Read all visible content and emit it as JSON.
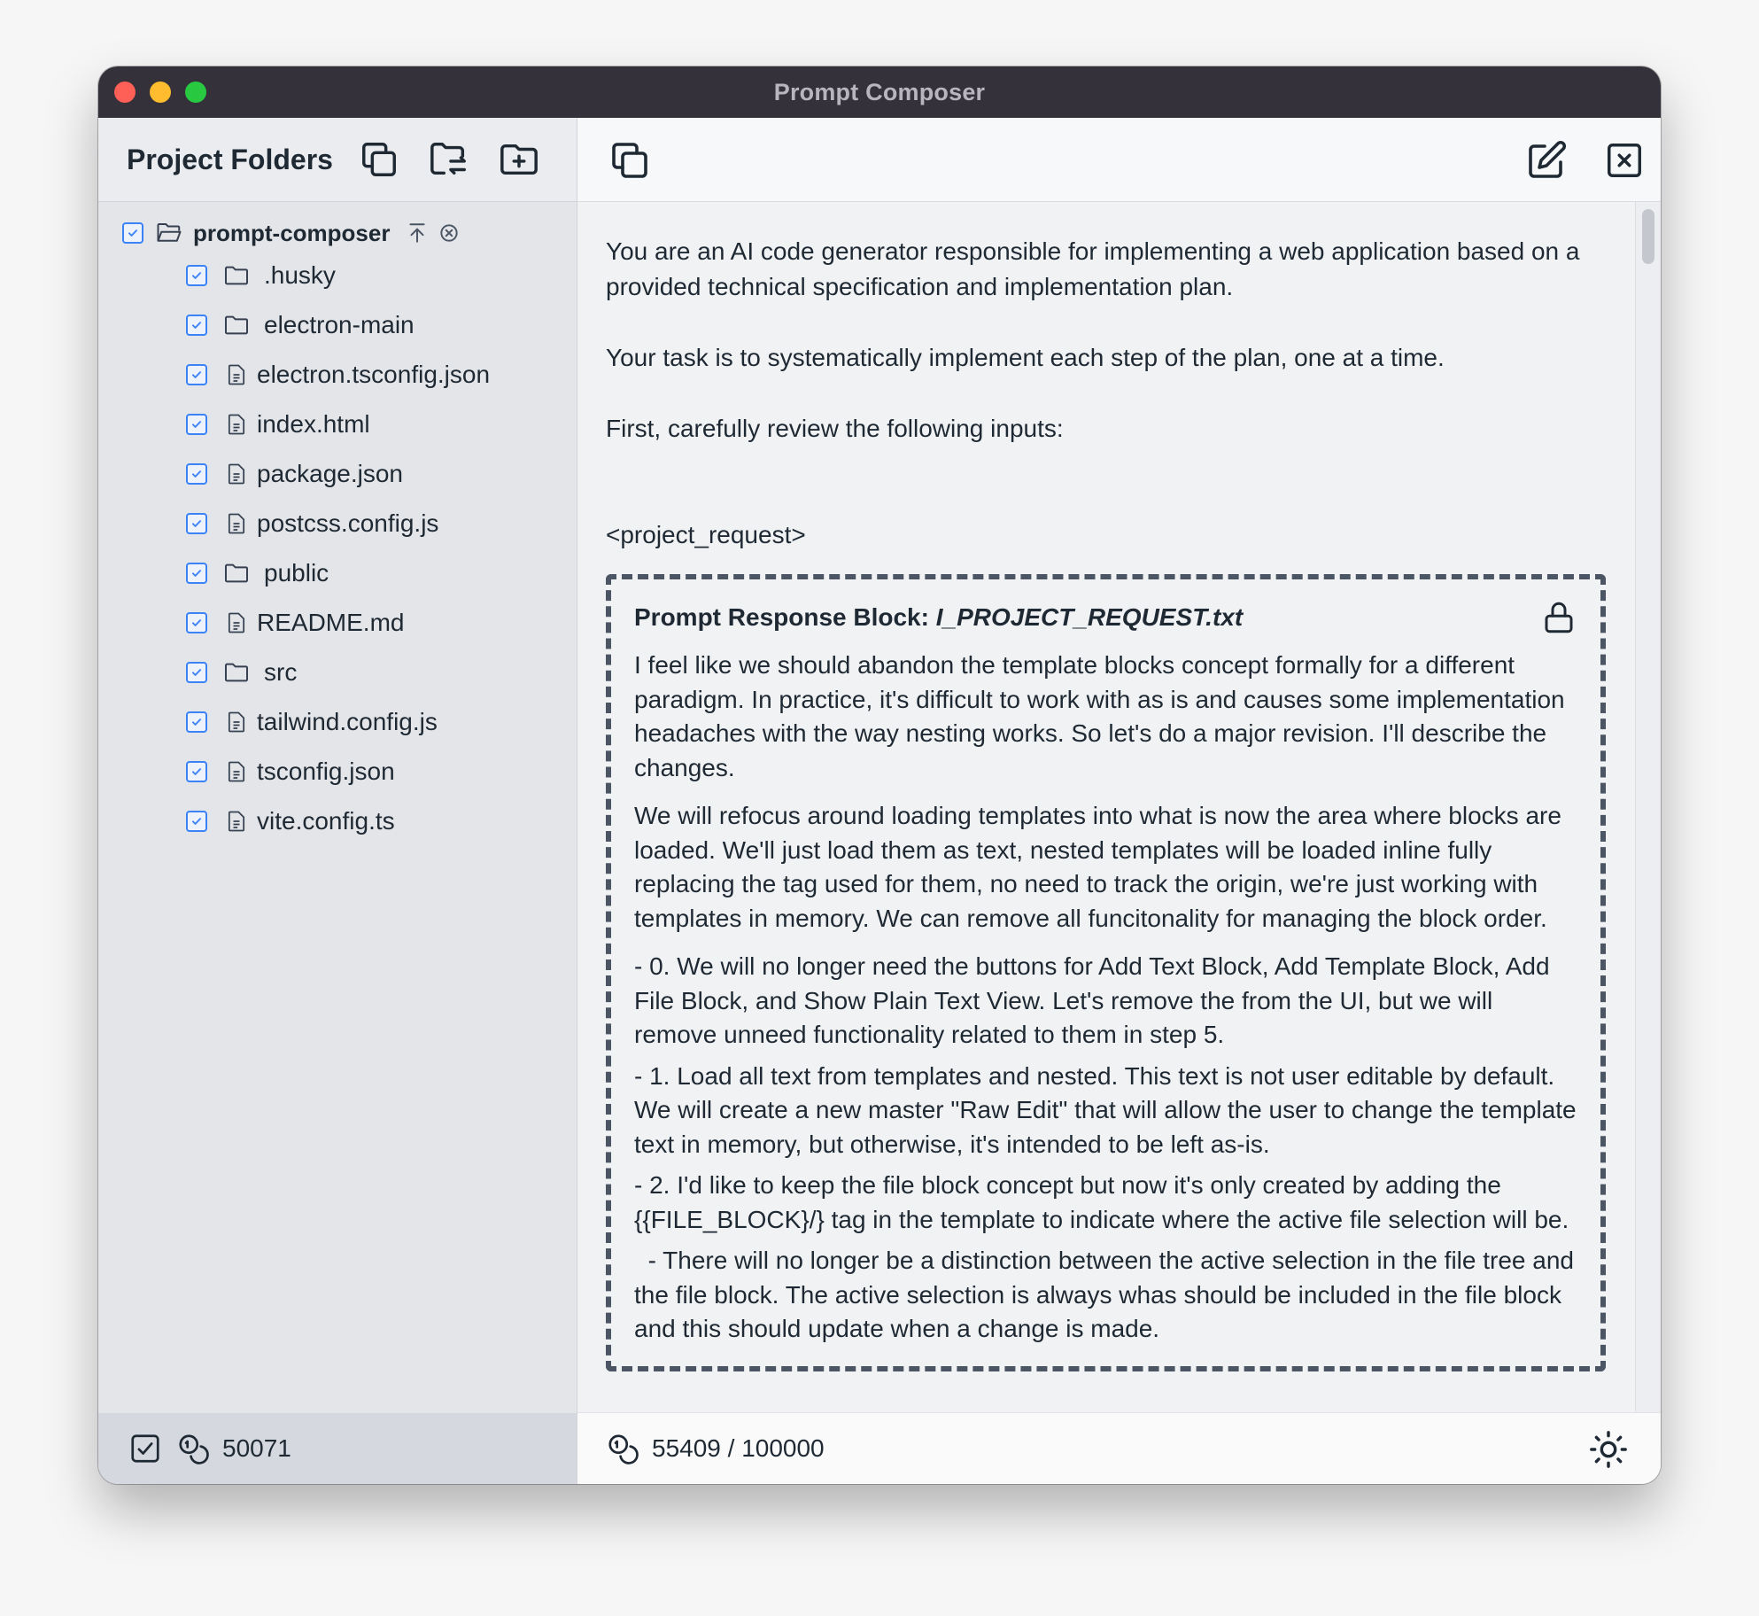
{
  "window": {
    "title": "Prompt Composer"
  },
  "sidebar": {
    "title": "Project Folders",
    "root": {
      "name": "prompt-composer"
    },
    "items": [
      {
        "name": ".husky",
        "kind": "folder"
      },
      {
        "name": "electron-main",
        "kind": "folder"
      },
      {
        "name": "electron.tsconfig.json",
        "kind": "file"
      },
      {
        "name": "index.html",
        "kind": "file"
      },
      {
        "name": "package.json",
        "kind": "file"
      },
      {
        "name": "postcss.config.js",
        "kind": "file"
      },
      {
        "name": "public",
        "kind": "folder"
      },
      {
        "name": "README.md",
        "kind": "file"
      },
      {
        "name": "src",
        "kind": "folder"
      },
      {
        "name": "tailwind.config.js",
        "kind": "file"
      },
      {
        "name": "tsconfig.json",
        "kind": "file"
      },
      {
        "name": "vite.config.ts",
        "kind": "file"
      }
    ],
    "footer_count": "50071"
  },
  "editor": {
    "paragraphs": [
      "You are an AI code generator responsible for implementing a web application based on a provided technical specification and implementation plan.",
      "Your task is to systematically implement each step of the plan, one at a time.",
      "First, carefully review the following inputs:"
    ],
    "tag_open": "<project_request>",
    "block": {
      "title_prefix": "Prompt Response Block:",
      "title_file": "I_PROJECT_REQUEST.txt",
      "paragraphs": [
        "I feel like we should abandon the template blocks concept formally for a different paradigm. In practice, it's difficult to work with as is and causes some implementation headaches with the way nesting works. So let's do a major revision. I'll describe the changes.",
        "We will refocus around loading templates into what is now the area where blocks are loaded. We'll just load them as text, nested templates will be loaded inline fully replacing the tag used for them, no need to track the origin, we're just working with templates in memory. We can remove all funcitonality for managing the block order.",
        "- 0. We will no longer need the buttons for Add Text Block, Add Template Block, Add File Block, and Show Plain Text View. Let's remove the from the UI, but we will remove unneed functionality related to them in step 5.",
        "- 1. Load all text from templates and nested. This text is not user editable by default. We will create a new master \"Raw Edit\" that will allow the user to change the template text in memory, but otherwise, it's intended to be left as-is.",
        "- 2. I'd like to keep the file block concept but now it's only created by adding the {{FILE_BLOCK}/} tag in the template to indicate where the active file selection will be.",
        "  - There will no longer be a distinction between the active selection in the file tree and the file block. The active selection is always whas should be included in the file block and this should update when a change is made."
      ]
    },
    "token_usage": "55409 / 100000"
  }
}
